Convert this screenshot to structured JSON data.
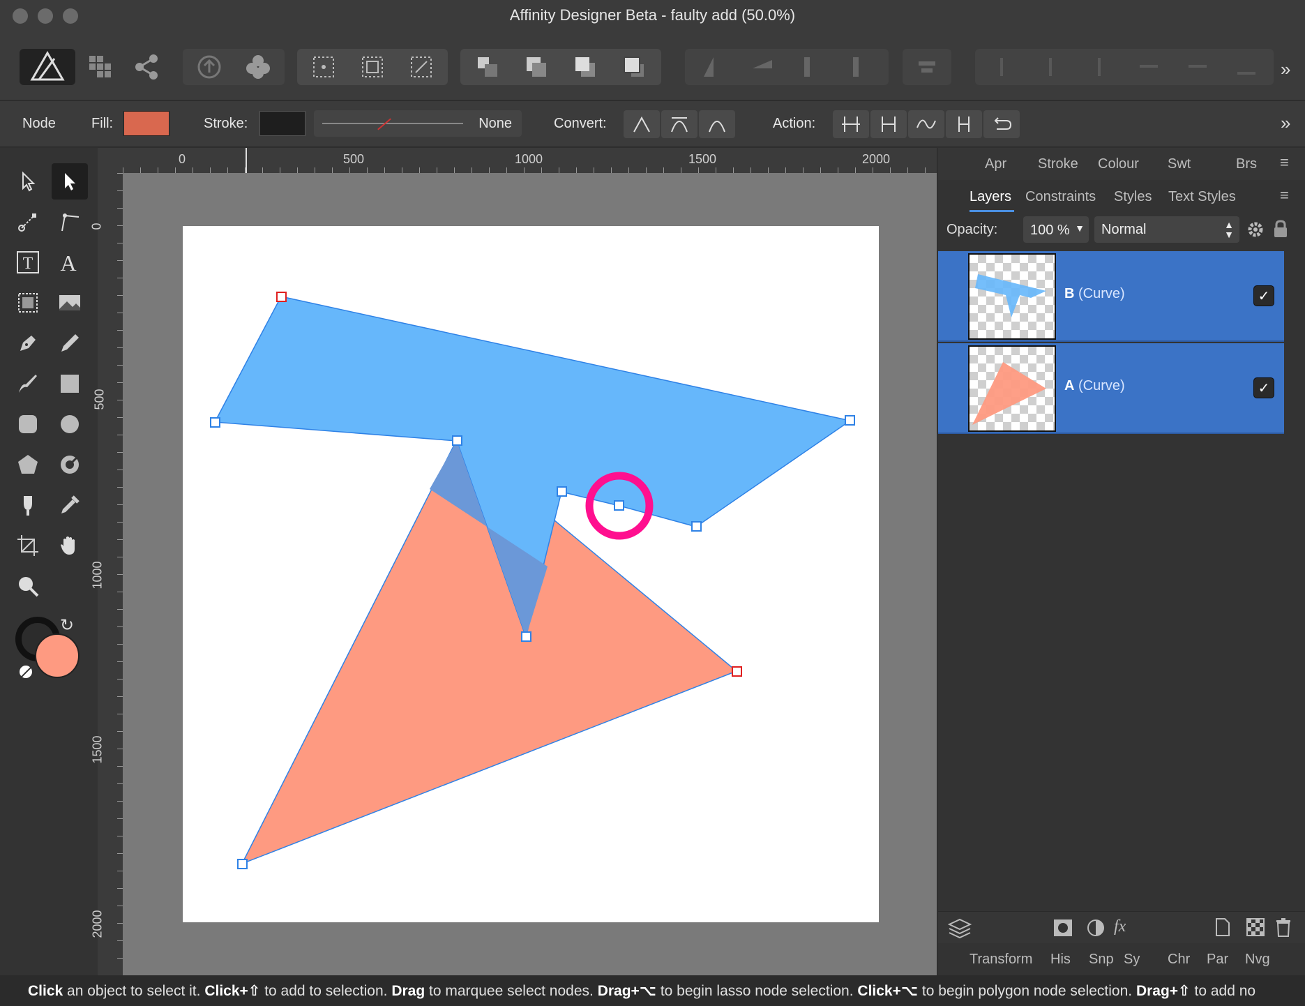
{
  "window": {
    "title": "Affinity Designer Beta - faulty add (50.0%)"
  },
  "context_toolbar": {
    "tool_label": "Node",
    "fill_label": "Fill:",
    "fill_color": "#d9684f",
    "stroke_label": "Stroke:",
    "stroke_color": "#1e1e1e",
    "stroke_width_value": "None",
    "convert_label": "Convert:",
    "action_label": "Action:"
  },
  "rulers": {
    "unit": "px",
    "top_ticks": [
      "0",
      "500",
      "1000",
      "1500",
      "2000"
    ],
    "left_ticks": [
      "0",
      "500",
      "1000",
      "1500",
      "2000"
    ]
  },
  "canvas": {
    "shape_b_fill": "#66b7fb",
    "shape_a_fill": "#fe9a81",
    "overlap_fill": "#6b98d8",
    "node_outline": "#2f82e6",
    "end_node_outline": "#e02020",
    "highlight_ring": "#ff0f8f"
  },
  "studio_top": {
    "tabs": [
      "Apr",
      "Stroke",
      "Colour",
      "Swt",
      "Brs"
    ]
  },
  "layers_panel": {
    "tabs": [
      "Layers",
      "Constraints",
      "Styles",
      "Text Styles"
    ],
    "active_tab": "Layers",
    "opacity_label": "Opacity:",
    "opacity_value": "100 %",
    "blend_mode": "Normal",
    "layers": [
      {
        "letter": "B",
        "type": "(Curve)",
        "visible": true
      },
      {
        "letter": "A",
        "type": "(Curve)",
        "visible": true
      }
    ],
    "row_color": "#3b73c6"
  },
  "studio_bottom": {
    "tabs": [
      "Transform",
      "His",
      "Snp",
      "Sy",
      "Chr",
      "Par",
      "Nvg"
    ]
  },
  "colour_well": {
    "fill": "#fe9a81",
    "stroke": "#111111"
  },
  "status": {
    "s1": "Click",
    "t1": " an object to select it. ",
    "s2": "Click+⇧",
    "t2": " to add to selection. ",
    "s3": "Drag",
    "t3": " to marquee select nodes. ",
    "s4": "Drag+⌥",
    "t4": " to begin lasso node selection. ",
    "s5": "Click+⌥",
    "t5": " to begin polygon node selection. ",
    "s6": "Drag+⇧",
    "t6": " to add no"
  }
}
